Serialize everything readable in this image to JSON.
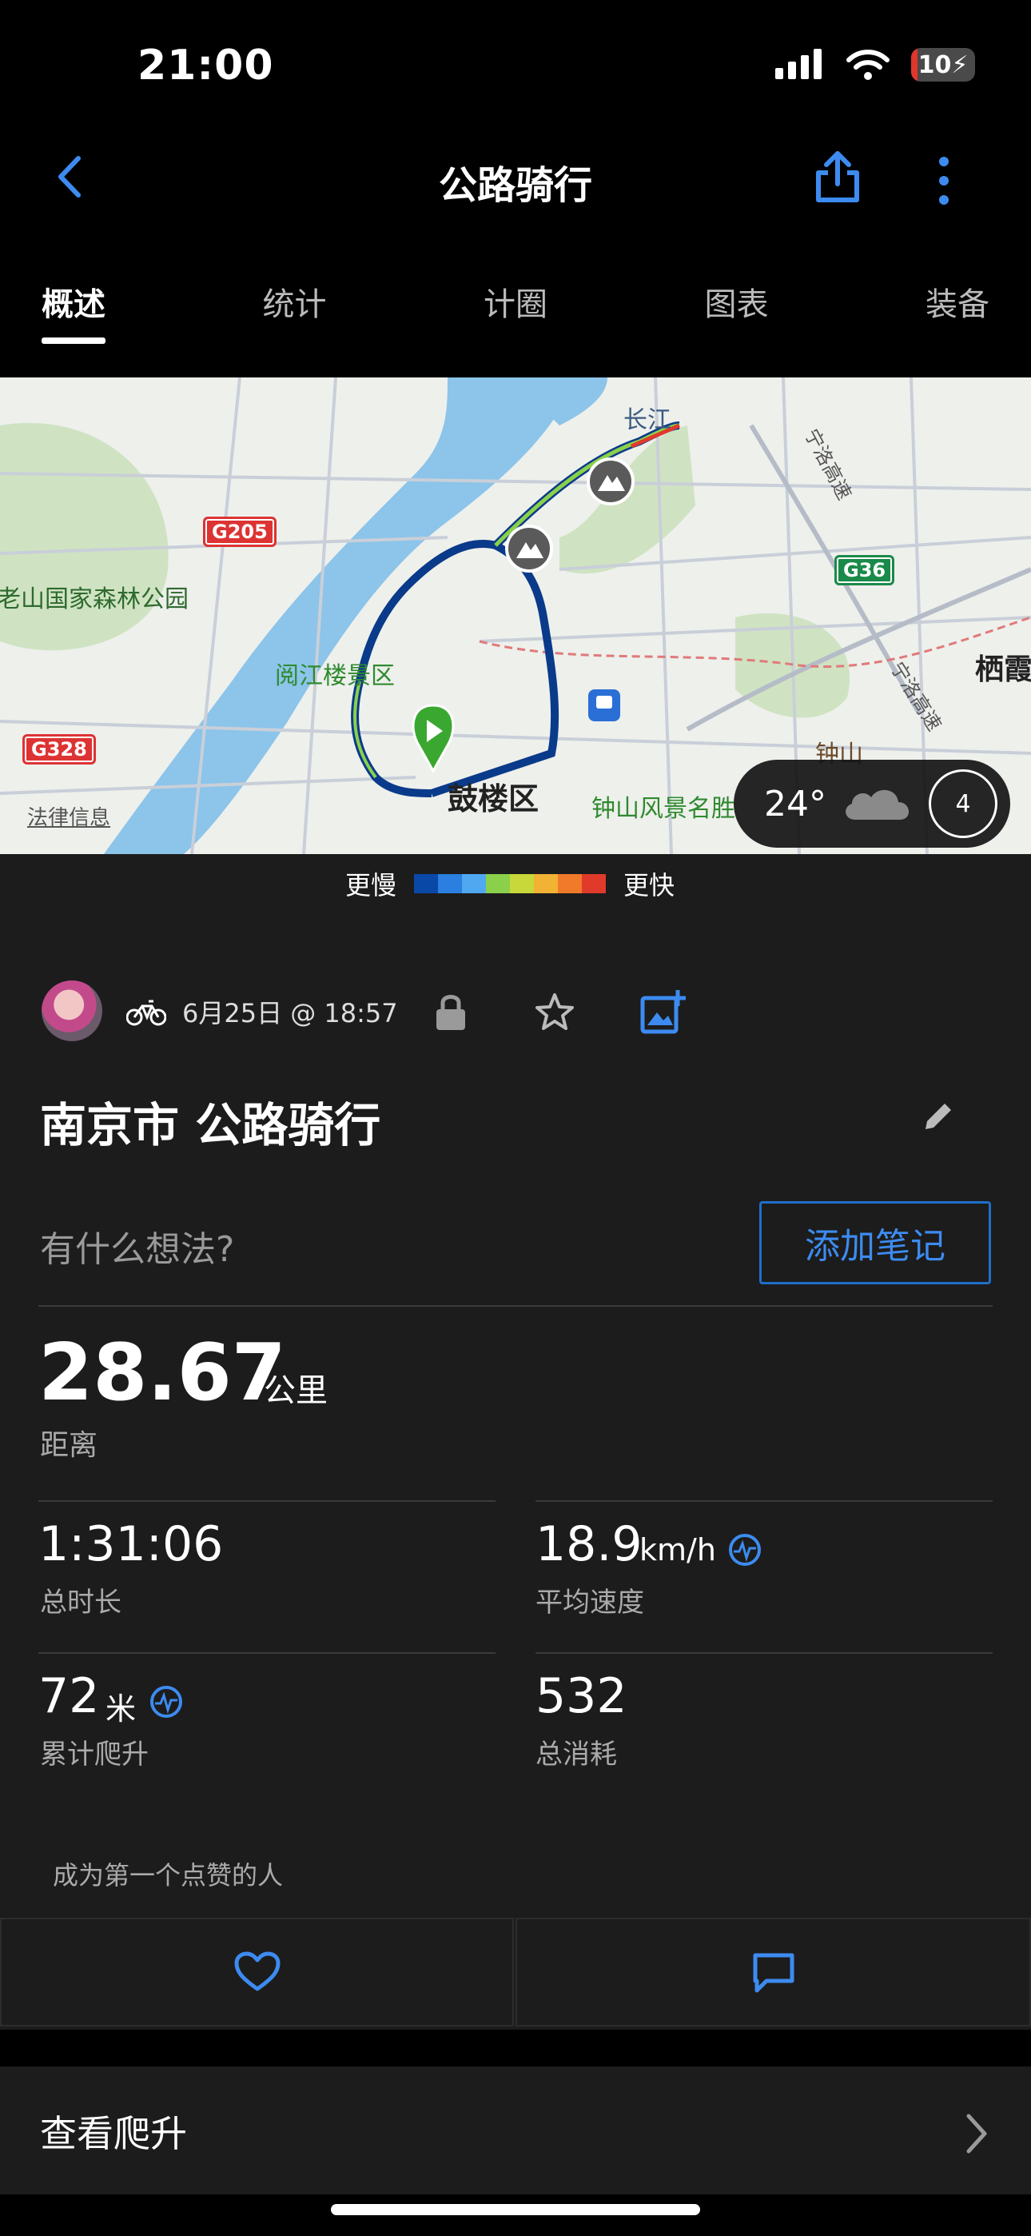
{
  "status_bar": {
    "time": "21:00",
    "battery": "10",
    "battery_level": 0.1
  },
  "nav": {
    "title": "公路骑行"
  },
  "tabs": [
    {
      "label": "概述",
      "active": true
    },
    {
      "label": "统计"
    },
    {
      "label": "计圈"
    },
    {
      "label": "图表"
    },
    {
      "label": "装备"
    }
  ],
  "map": {
    "labels": {
      "yangtze": "长江",
      "ningluo_1": "宁洛高速",
      "ningluo_2": "宁洛高速",
      "laoshan": "老山国家森林公园",
      "yuejianglou": "阅江楼景区",
      "gulou": "鼓楼区",
      "zhongshan_scenic": "钟山风景名胜",
      "zhongshan": "钟山",
      "qixia": "栖霞",
      "legal": "法律信息"
    },
    "road_badges": {
      "g205": "G205",
      "g36": "G36",
      "g328": "G328"
    },
    "weather": {
      "temperature": "24°",
      "icon": "cloud-icon",
      "wind": "4"
    }
  },
  "legend": {
    "slower": "更慢",
    "faster": "更快",
    "colors": [
      "#0a48a8",
      "#2a7fe0",
      "#4fa8f0",
      "#8bd04a",
      "#c8d83a",
      "#f2b233",
      "#f07a2a",
      "#e03a2a"
    ]
  },
  "activity": {
    "date": "6月25日 @ 18:57",
    "title": "南京市 公路骑行",
    "notes_placeholder": "有什么想法?",
    "add_note": "添加笔记"
  },
  "stats": {
    "distance": {
      "value": "28.67",
      "unit": "公里",
      "label": "距离"
    },
    "duration": {
      "value": "1:31:06",
      "label": "总时长"
    },
    "avg_speed": {
      "value": "18.9",
      "unit": "km/h",
      "label": "平均速度"
    },
    "elevation": {
      "value": "72",
      "unit": "米",
      "label": "累计爬升"
    },
    "calories": {
      "value": "532",
      "label": "总消耗"
    }
  },
  "social": {
    "likes_text": "成为第一个点赞的人"
  },
  "climb": {
    "label": "查看爬升"
  },
  "colors": {
    "accent": "#3d8bf0",
    "card_bg": "#1c1c1c",
    "route_start": "#3aa830"
  }
}
